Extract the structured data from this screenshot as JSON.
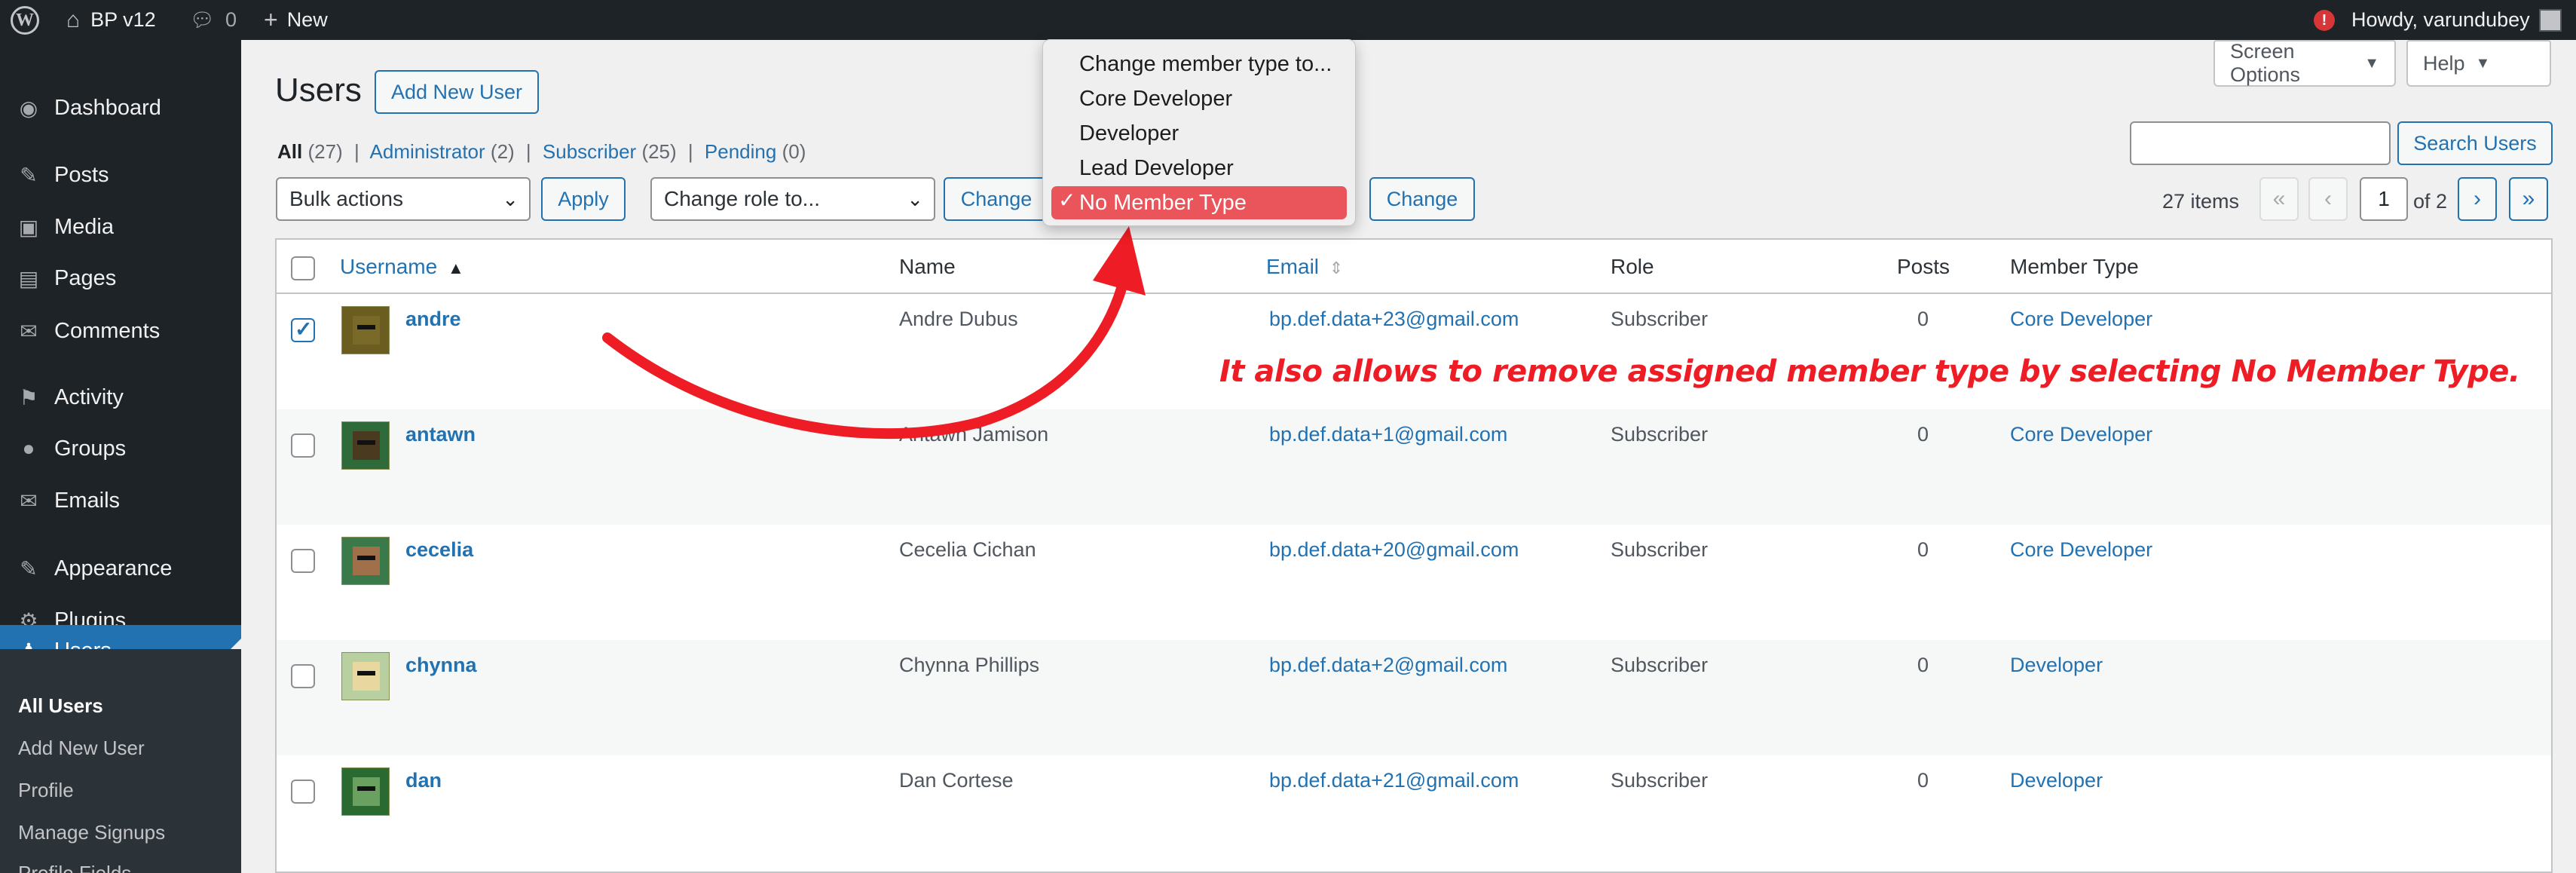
{
  "adminbar": {
    "site_name": "BP v12",
    "comments_count": "0",
    "new_label": "New",
    "alert_count": "!",
    "howdy": "Howdy, varundubey"
  },
  "sidebar": {
    "items": [
      {
        "label": "Dashboard",
        "icon": "dashboard-icon",
        "glyph": "◉"
      },
      {
        "label": "Posts",
        "icon": "pin-icon",
        "glyph": "✎"
      },
      {
        "label": "Media",
        "icon": "media-icon",
        "glyph": "▣"
      },
      {
        "label": "Pages",
        "icon": "pages-icon",
        "glyph": "▤"
      },
      {
        "label": "Comments",
        "icon": "comment-icon",
        "glyph": "✉"
      },
      {
        "label": "Activity",
        "icon": "activity-icon",
        "glyph": "⚑"
      },
      {
        "label": "Groups",
        "icon": "groups-icon",
        "glyph": "●"
      },
      {
        "label": "Emails",
        "icon": "email-icon",
        "glyph": "✉"
      },
      {
        "label": "Appearance",
        "icon": "appearance-icon",
        "glyph": "✎"
      },
      {
        "label": "Plugins",
        "icon": "plugins-icon",
        "glyph": "⚙"
      },
      {
        "label": "Users",
        "icon": "users-icon",
        "glyph": "♟"
      }
    ],
    "submenu": [
      "All Users",
      "Add New User",
      "Profile",
      "Manage Signups",
      "Profile Fields"
    ]
  },
  "header": {
    "title": "Users",
    "add_new": "Add New User",
    "screen_options": "Screen Options",
    "help": "Help"
  },
  "filters": {
    "all_label": "All",
    "all_count": "(27)",
    "admin_label": "Administrator",
    "admin_count": "(2)",
    "sub_label": "Subscriber",
    "sub_count": "(25)",
    "pending_label": "Pending",
    "pending_count": "(0)",
    "sep": "|"
  },
  "search": {
    "button": "Search Users",
    "value": ""
  },
  "tablenav": {
    "bulk": "Bulk actions",
    "apply": "Apply",
    "change_role": "Change role to...",
    "change": "Change",
    "change2": "Change",
    "items": "27 items",
    "first": "«",
    "prev": "‹",
    "page": "1",
    "of": "of 2",
    "next": "›",
    "last": "»"
  },
  "table": {
    "headers": {
      "username": "Username",
      "name": "Name",
      "email": "Email",
      "role": "Role",
      "posts": "Posts",
      "member_type": "Member Type"
    },
    "rows": [
      {
        "username": "andre",
        "name": "Andre Dubus",
        "email": "bp.def.data+23@gmail.com",
        "role": "Subscriber",
        "posts": "0",
        "member_type": "Core Developer",
        "checked": true,
        "skin": "#7a6a2a",
        "bg": "#6b5c20"
      },
      {
        "username": "antawn",
        "name": "Antawn Jamison",
        "email": "bp.def.data+1@gmail.com",
        "role": "Subscriber",
        "posts": "0",
        "member_type": "Core Developer",
        "checked": false,
        "skin": "#4a3a20",
        "bg": "#2f6b3a"
      },
      {
        "username": "cecelia",
        "name": "Cecelia Cichan",
        "email": "bp.def.data+20@gmail.com",
        "role": "Subscriber",
        "posts": "0",
        "member_type": "Core Developer",
        "checked": false,
        "skin": "#a0704a",
        "bg": "#3a7a4a"
      },
      {
        "username": "chynna",
        "name": "Chynna Phillips",
        "email": "bp.def.data+2@gmail.com",
        "role": "Subscriber",
        "posts": "0",
        "member_type": "Developer",
        "checked": false,
        "skin": "#e8d8a0",
        "bg": "#b8d0a0"
      },
      {
        "username": "dan",
        "name": "Dan Cortese",
        "email": "bp.def.data+21@gmail.com",
        "role": "Subscriber",
        "posts": "0",
        "member_type": "Developer",
        "checked": false,
        "skin": "#6aa060",
        "bg": "#2a6a30"
      }
    ]
  },
  "dropdown": {
    "options": [
      "Change member type to...",
      "Core Developer",
      "Developer",
      "Lead Developer",
      "No Member Type"
    ],
    "selected": "No Member Type",
    "checkmark": "✓"
  },
  "annotation": "It also allows to remove assigned member type by selecting No Member Type.",
  "colors": {
    "accent": "#2271b1",
    "admin_dark": "#1d2327",
    "annotation": "#ee1c24",
    "selected_option": "#e9555a"
  }
}
